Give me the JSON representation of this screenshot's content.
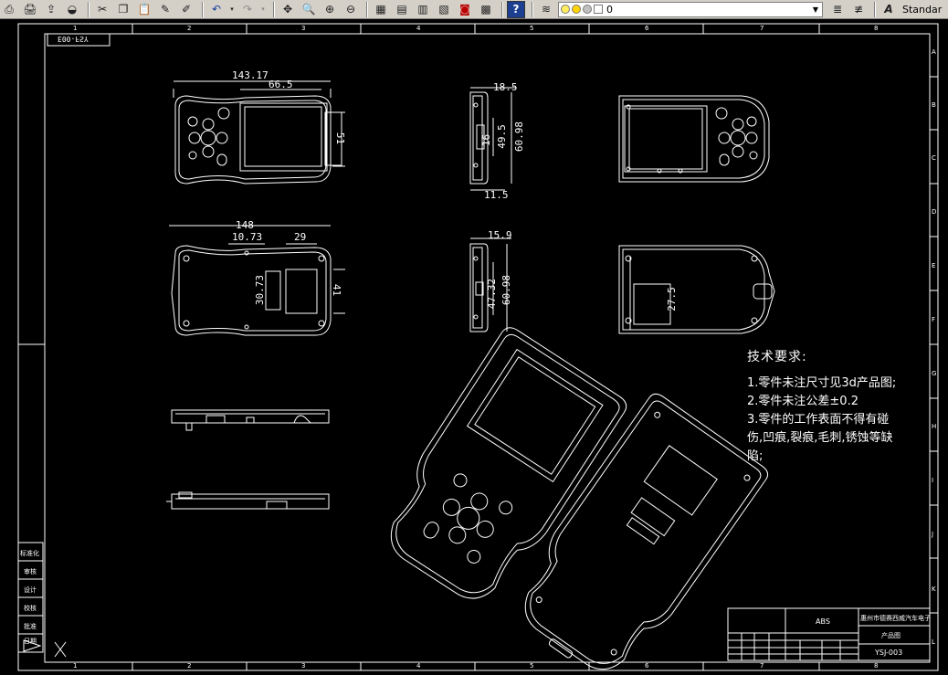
{
  "toolbar": {
    "icons": [
      "plot-preview-icon",
      "plot-icon",
      "publish-icon",
      "cut-icon",
      "copy-icon",
      "paste-icon",
      "match-properties-icon",
      "block-editor-icon",
      "undo-icon",
      "redo-icon",
      "pan-icon",
      "zoom-realtime-icon",
      "zoom-window-icon",
      "zoom-previous-icon",
      "properties-icon",
      "design-center-icon",
      "tool-palettes-icon",
      "sheet-set-icon",
      "markup-icon",
      "quickcalc-icon",
      "help-icon"
    ],
    "layer_value": "0",
    "layer_state_icons": [
      "lightbulb-icon",
      "sun-icon",
      "lock-icon",
      "color-swatch-icon"
    ],
    "text_style_value": "Standar"
  },
  "ruler": {
    "columns": [
      "1",
      "2",
      "3",
      "4",
      "5",
      "6",
      "7",
      "8"
    ],
    "rows": [
      "A",
      "B",
      "C",
      "D",
      "E",
      "F",
      "G",
      "H",
      "I",
      "J",
      "K",
      "L"
    ]
  },
  "dimensions": {
    "top_width": "143.17",
    "top_screen_width": "66.5",
    "top_screen_height": "51",
    "side1_depth": "18.5",
    "side1_a": "16",
    "side1_b": "49.5",
    "side1_c": "60.98",
    "side1_bottom": "11.5",
    "back_width": "148",
    "back_a": "10.73",
    "back_b": "29",
    "back_c": "30.73",
    "back_d": "41",
    "side2_depth": "15.9",
    "side2_a": "47.32",
    "side2_b": "60.98",
    "inner_dim": "27.5"
  },
  "notes": {
    "title": "技术要求:",
    "lines": [
      "1.零件未注尺寸见3d产品图;",
      "2.零件未注公差±0.2",
      "3.零件的工作表面不得有碰",
      "伤,凹痕,裂痕,毛刺,锈蚀等缺",
      "陷;"
    ]
  },
  "stamp": "E00-FSY",
  "title_block": {
    "material": "ABS",
    "company": "惠州市德赛西威汽车电子",
    "part_name": "产品图",
    "drawing_no": "YSJ-003"
  },
  "left_labels": [
    "标准化",
    "审核",
    "设计",
    "校核",
    "批准",
    "日期"
  ],
  "colors": {
    "background": "#000000",
    "lines": "#ffffff",
    "toolbar": "#d4d0c8"
  }
}
